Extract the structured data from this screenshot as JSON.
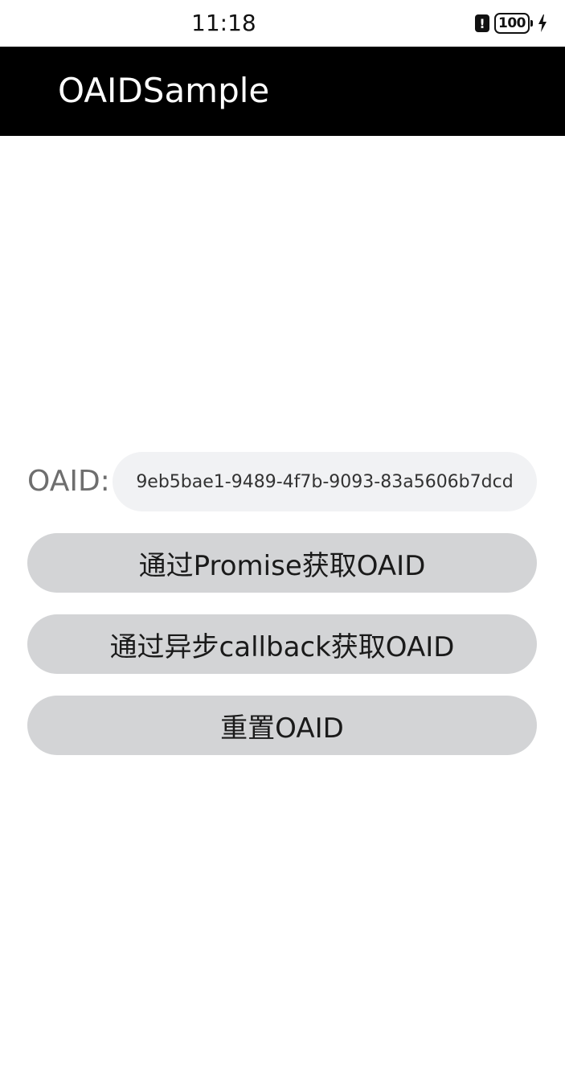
{
  "status_bar": {
    "time": "11:18",
    "alert_glyph": "!",
    "battery_level": "100",
    "icons": [
      "alert-icon",
      "battery-icon",
      "charging-icon"
    ]
  },
  "app_bar": {
    "title": "OAIDSample",
    "background": "#000000"
  },
  "oaid": {
    "label": "OAID:",
    "value": "9eb5bae1-9489-4f7b-9093-83a5606b7dcd"
  },
  "buttons": {
    "promise": "通过Promise获取OAID",
    "callback": "通过异步callback获取OAID",
    "reset": "重置OAID"
  },
  "colors": {
    "button_bg": "#d3d4d6",
    "field_bg": "#f1f2f4"
  }
}
